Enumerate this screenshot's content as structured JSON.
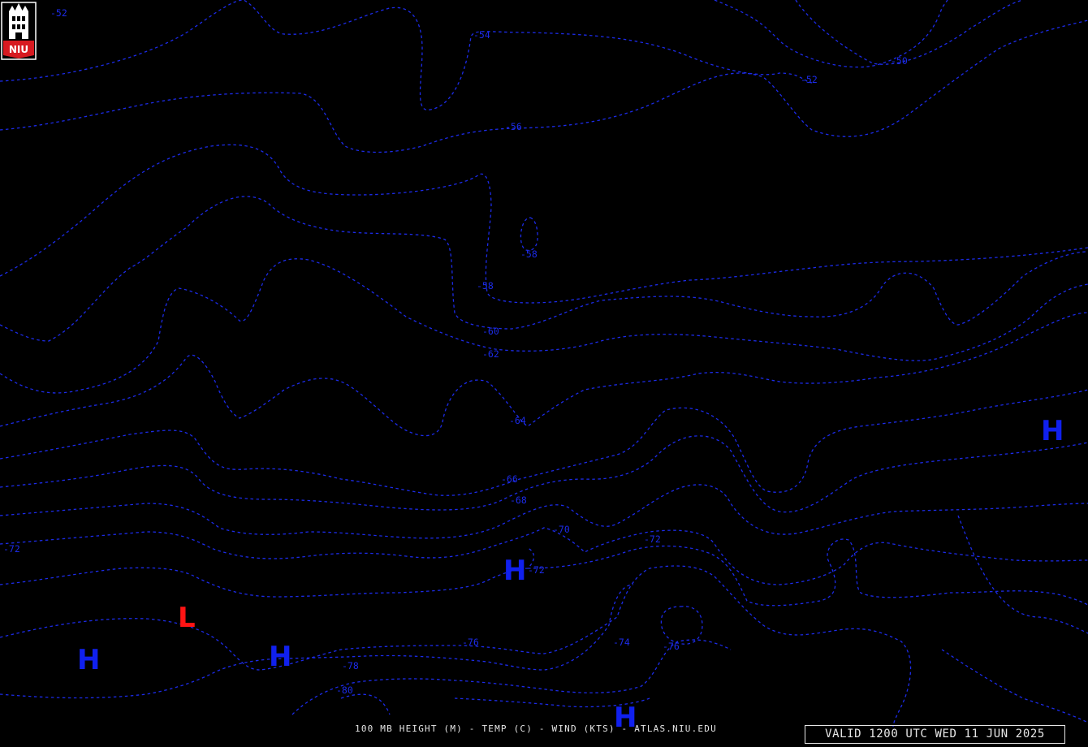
{
  "map": {
    "caption": "100 MB HEIGHT (M) - TEMP (C) - WIND (KTS) - ATLAS.NIU.EDU",
    "valid_time": "VALID 1200 UTC WED 11 JUN 2025",
    "contour_color": "#1c2be8",
    "high_color": "#1020ee",
    "low_color": "#ff1414",
    "logo_text": "NIU",
    "contour_labels": [
      "-52",
      "-54",
      "-50",
      "-52",
      "-56",
      "-58",
      "-58",
      "-60",
      "-62",
      "-64",
      "-66",
      "-68",
      "-70",
      "-72",
      "-72",
      "-72",
      "-76",
      "-74",
      "-76",
      "-78",
      "-80"
    ],
    "pressure_centers": [
      "H",
      "H",
      "L",
      "H",
      "H",
      "H"
    ]
  }
}
